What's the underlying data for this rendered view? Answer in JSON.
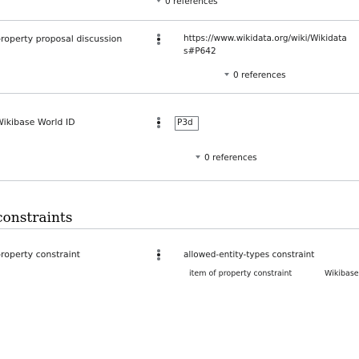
{
  "top_references": "0 references",
  "statements": [
    {
      "property": "property proposal discussion",
      "value_line1": "https://www.wikidata.org/wiki/Wikidata",
      "value_line2": "s#P642",
      "references": "0 references"
    },
    {
      "property": "Wikibase World ID",
      "value": "P3d",
      "references": "0 references"
    }
  ],
  "section_heading": "constraints",
  "constraint": {
    "property": "property constraint",
    "value": "allowed-entity-types constraint",
    "qualifier_label": "item of property constraint",
    "qualifier_value": "Wikibase"
  },
  "colors": {
    "rule": "#c8ccd1",
    "text": "#202122",
    "icon": "#72777d"
  }
}
